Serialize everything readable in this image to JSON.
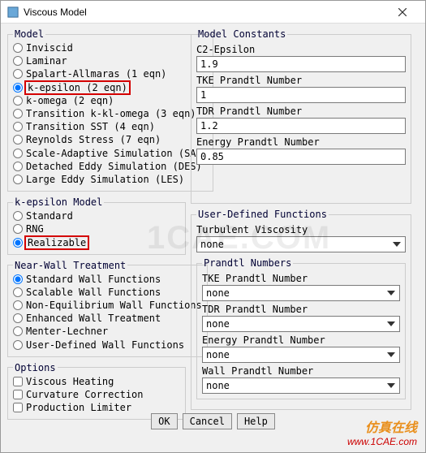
{
  "window": {
    "title": "Viscous Model"
  },
  "model": {
    "legend": "Model",
    "items": [
      {
        "label": "Inviscid",
        "checked": false
      },
      {
        "label": "Laminar",
        "checked": false
      },
      {
        "label": "Spalart-Allmaras (1 eqn)",
        "checked": false
      },
      {
        "label": "k-epsilon (2 eqn)",
        "checked": true,
        "highlight": true
      },
      {
        "label": "k-omega (2 eqn)",
        "checked": false
      },
      {
        "label": "Transition k-kl-omega (3 eqn)",
        "checked": false
      },
      {
        "label": "Transition SST (4 eqn)",
        "checked": false
      },
      {
        "label": "Reynolds Stress (7 eqn)",
        "checked": false
      },
      {
        "label": "Scale-Adaptive Simulation (SAS)",
        "checked": false
      },
      {
        "label": "Detached Eddy Simulation (DES)",
        "checked": false
      },
      {
        "label": "Large Eddy Simulation (LES)",
        "checked": false
      }
    ]
  },
  "ke_model": {
    "legend": "k-epsilon Model",
    "items": [
      {
        "label": "Standard",
        "checked": false
      },
      {
        "label": "RNG",
        "checked": false
      },
      {
        "label": "Realizable",
        "checked": true,
        "highlight": true
      }
    ]
  },
  "near_wall": {
    "legend": "Near-Wall Treatment",
    "items": [
      {
        "label": "Standard Wall Functions",
        "checked": true
      },
      {
        "label": "Scalable Wall Functions",
        "checked": false
      },
      {
        "label": "Non-Equilibrium Wall Functions",
        "checked": false
      },
      {
        "label": "Enhanced Wall Treatment",
        "checked": false
      },
      {
        "label": "Menter-Lechner",
        "checked": false
      },
      {
        "label": "User-Defined Wall Functions",
        "checked": false
      }
    ]
  },
  "options": {
    "legend": "Options",
    "items": [
      {
        "label": "Viscous Heating",
        "checked": false
      },
      {
        "label": "Curvature Correction",
        "checked": false
      },
      {
        "label": "Production Limiter",
        "checked": false
      }
    ]
  },
  "constants": {
    "legend": "Model Constants",
    "fields": [
      {
        "label": "C2-Epsilon",
        "value": "1.9"
      },
      {
        "label": "TKE Prandtl Number",
        "value": "1"
      },
      {
        "label": "TDR Prandtl Number",
        "value": "1.2"
      },
      {
        "label": "Energy Prandtl Number",
        "value": "0.85"
      }
    ]
  },
  "udf": {
    "legend": "User-Defined Functions",
    "turb_visc_label": "Turbulent Viscosity",
    "turb_visc_value": "none",
    "prandtl_legend": "Prandtl Numbers",
    "prandtl": [
      {
        "label": "TKE Prandtl Number",
        "value": "none"
      },
      {
        "label": "TDR Prandtl Number",
        "value": "none"
      },
      {
        "label": "Energy Prandtl Number",
        "value": "none"
      },
      {
        "label": "Wall Prandtl Number",
        "value": "none"
      }
    ]
  },
  "buttons": {
    "ok": "OK",
    "cancel": "Cancel",
    "help": "Help"
  },
  "watermark": "1CAE.COM",
  "brand": {
    "cn": "仿真在线",
    "url": "www.1CAE.com"
  }
}
